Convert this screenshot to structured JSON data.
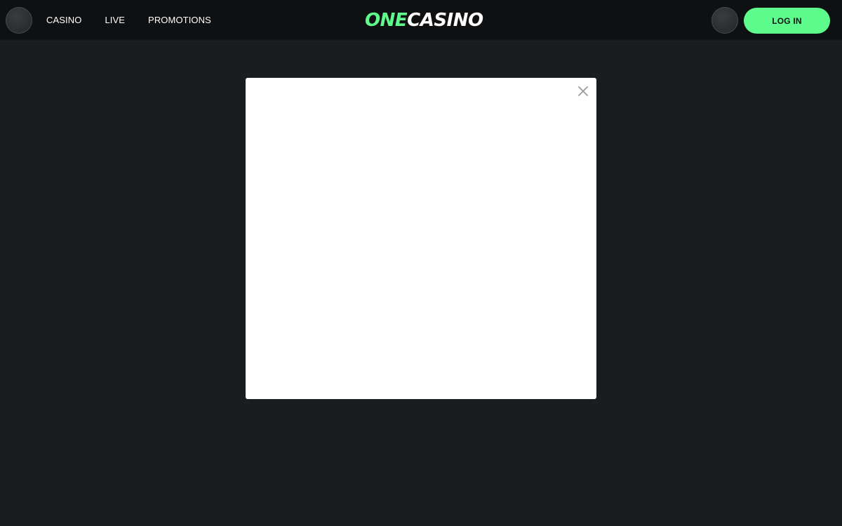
{
  "header": {
    "nav_items": [
      {
        "label": "CASINO"
      },
      {
        "label": "LIVE"
      },
      {
        "label": "PROMOTIONS"
      }
    ],
    "logo": {
      "part_one": "ONE",
      "part_two": "CASINO"
    },
    "login_label": "LOG IN",
    "icons": {
      "menu": "menu-avatar-icon",
      "profile": "profile-avatar-icon"
    }
  },
  "modal": {
    "close_icon": "close-icon"
  },
  "colors": {
    "accent": "#5dfc8d",
    "background": "#1b1c1f",
    "topbar": "#0f1012",
    "modal": "#ffffff"
  }
}
